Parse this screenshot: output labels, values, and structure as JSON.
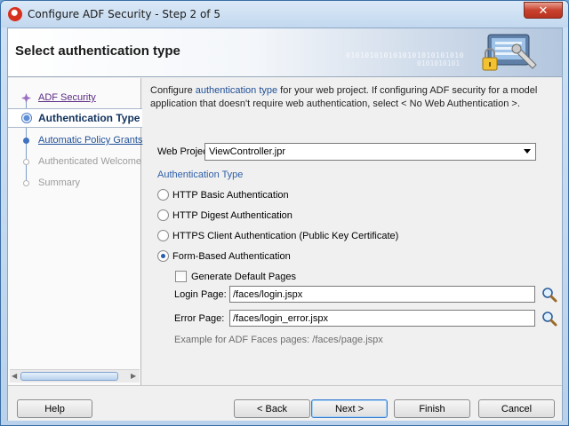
{
  "window": {
    "title": "Configure ADF Security - Step 2 of 5",
    "close_glyph": "✕"
  },
  "header": {
    "title": "Select authentication type",
    "binary_line1": "0101010101010101010101010",
    "binary_line2": "0101010101"
  },
  "nav": {
    "items": [
      {
        "label": "ADF Security",
        "state": "visited"
      },
      {
        "label": "Authentication Type",
        "state": "current"
      },
      {
        "label": "Automatic Policy Grants",
        "state": "link"
      },
      {
        "label": "Authenticated Welcome",
        "state": "disabled"
      },
      {
        "label": "Summary",
        "state": "disabled"
      }
    ],
    "scroll_left": "◀",
    "scroll_right": "▶"
  },
  "content": {
    "desc_part1": "Configure ",
    "desc_link": "authentication type",
    "desc_part2": " for your web project. If configuring ADF security for a model application that doesn't require web authentication, select < No Web Authentication >.",
    "web_project_label": "Web Project:",
    "web_project_value": "ViewController.jpr",
    "auth_type_label": "Authentication Type",
    "radios": [
      {
        "label": "HTTP Basic Authentication",
        "selected": false
      },
      {
        "label": "HTTP Digest Authentication",
        "selected": false
      },
      {
        "label": "HTTPS Client Authentication (Public Key Certificate)",
        "selected": false
      },
      {
        "label": "Form-Based Authentication",
        "selected": true
      }
    ],
    "generate_pages_label": "Generate Default Pages",
    "generate_pages_checked": false,
    "login_page_label": "Login Page:",
    "login_page_value": "/faces/login.jspx",
    "error_page_label": "Error Page:",
    "error_page_value": "/faces/login_error.jspx",
    "example_text": "Example for ADF Faces pages: /faces/page.jspx"
  },
  "footer": {
    "help": "Help",
    "back": "< Back",
    "next": "Next >",
    "finish": "Finish",
    "cancel": "Cancel"
  },
  "icons": {
    "title": "oracle-logo-icon",
    "header": "security-lock-icon",
    "search": "search-icon"
  },
  "colors": {
    "accent": "#1f4f97",
    "section_label": "#2f5fa8",
    "visited_link": "#5b2a84",
    "close_button": "#c8412d"
  }
}
